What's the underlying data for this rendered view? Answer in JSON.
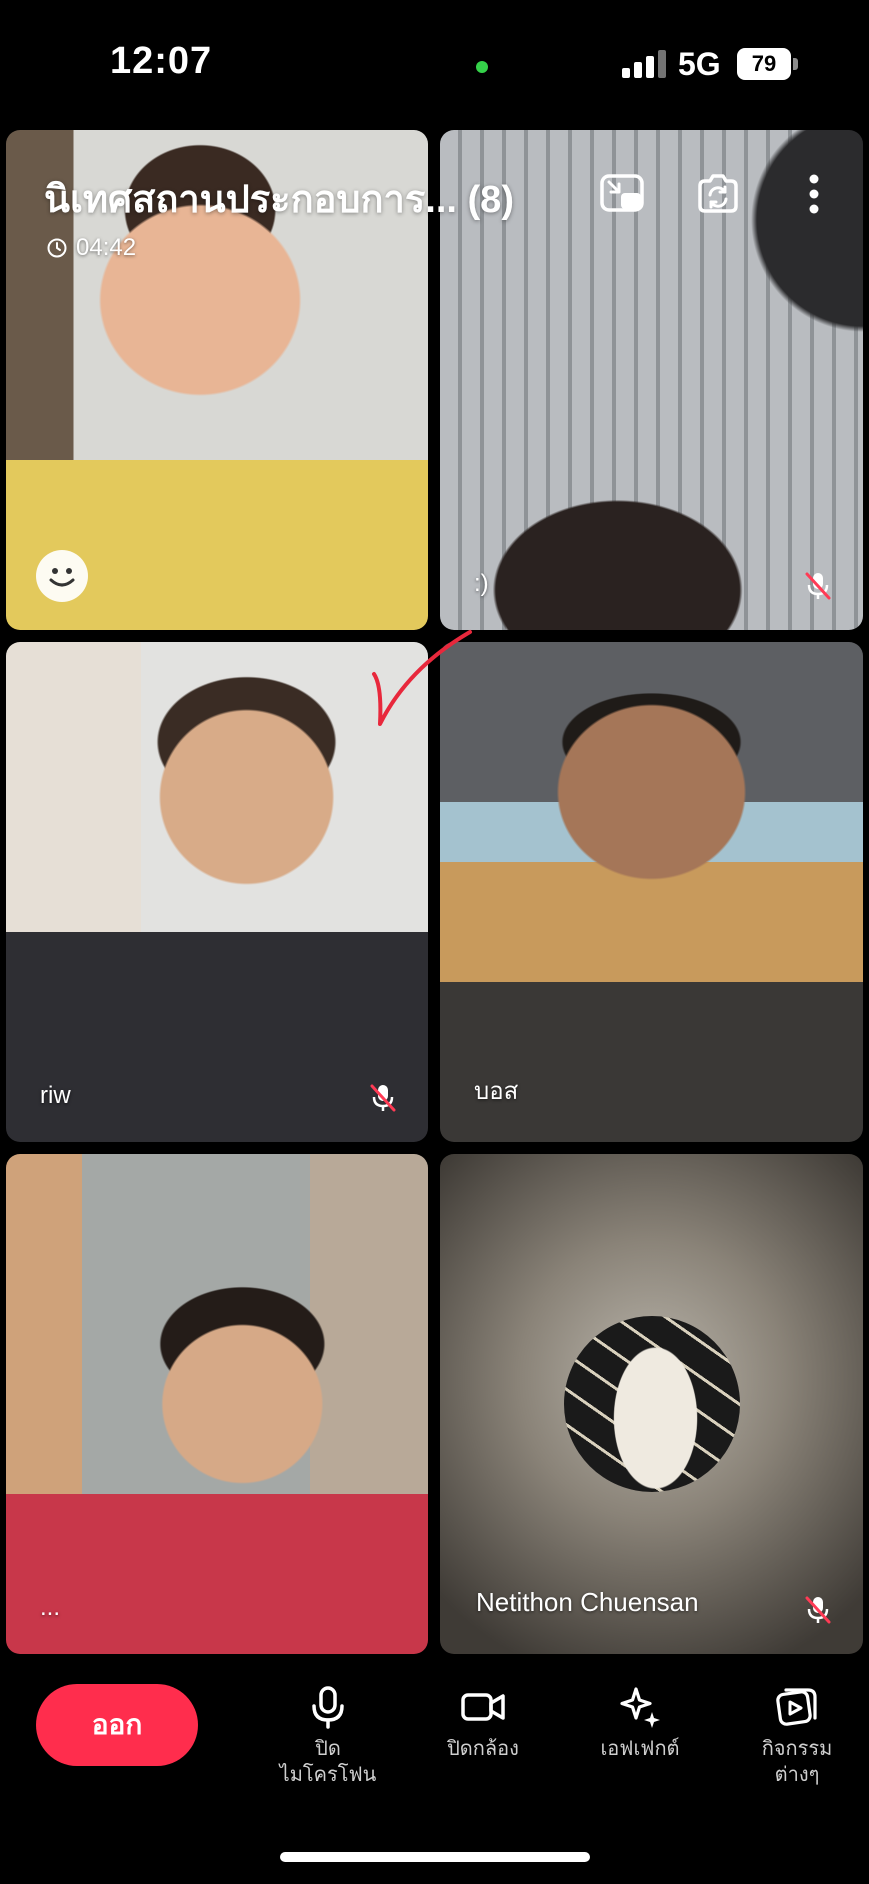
{
  "status_bar": {
    "time": "12:07",
    "network": "5G",
    "battery": "79"
  },
  "meeting": {
    "title": "นิเทศสถานประกอบการ... (8)",
    "timer": "04:42"
  },
  "tiles": [
    {
      "name": "",
      "muted": false
    },
    {
      "name": ":)",
      "muted": true
    },
    {
      "name": "riw",
      "muted": true
    },
    {
      "name": "บอส",
      "muted": false
    },
    {
      "name": "...",
      "muted": false
    },
    {
      "name": "Netithon Chuensan",
      "muted": true
    }
  ],
  "toolbar": {
    "leave_label": "ออก",
    "mic_label": "ปิด\nไมโครโฟน",
    "camera_label": "ปิดกล้อง",
    "effects_label": "เอฟเฟกต์",
    "activities_label": "กิจกรรม\nต่างๆ"
  },
  "colors": {
    "leave": "#ff2d4d",
    "active_dot": "#35d24a",
    "mute_slash": "#ff3b55",
    "annotation": "#e8283c"
  }
}
